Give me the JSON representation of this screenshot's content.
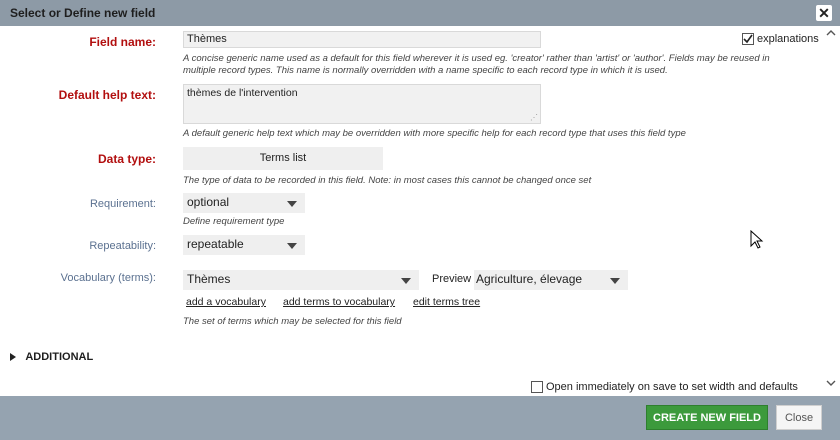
{
  "dialog": {
    "title": "Select or Define new field",
    "close_icon": "close-icon"
  },
  "field_name": {
    "label": "Field name:",
    "value": "Thèmes",
    "help": "A concise generic name used as a default for this field wherever it is used eg. 'creator' rather than 'artist' or 'author'. Fields may be reused in multiple record types. This name is normally overridden with a name specific to each record type in which it is used."
  },
  "explanations": {
    "label": "explanations",
    "checked": true
  },
  "default_help": {
    "label": "Default help text:",
    "value": "thèmes de l'intervention",
    "help": "A default generic help text which may be overridden with more specific help for each record type that uses this field type"
  },
  "data_type": {
    "label": "Data type:",
    "value": "Terms list",
    "help": "The type of data to be recorded in this field. Note: in most cases this cannot be changed once set"
  },
  "requirement": {
    "label": "Requirement:",
    "value": "optional",
    "help": "Define requirement type"
  },
  "repeatability": {
    "label": "Repeatability:",
    "value": "repeatable"
  },
  "vocabulary": {
    "label": "Vocabulary (terms):",
    "value": "Thèmes",
    "preview_label": "Preview",
    "preview_value": "Agriculture, élevage",
    "links": [
      "add a vocabulary",
      "add terms to vocabulary",
      "edit terms tree"
    ],
    "help": "The set of terms which may be selected for this field"
  },
  "additional": {
    "label": "ADDITIONAL"
  },
  "open_immediately": {
    "label": "Open immediately on save to set width and defaults",
    "checked": false
  },
  "buttons": {
    "create": "CREATE NEW FIELD",
    "close": "Close"
  },
  "colors": {
    "required_label": "#b20f0f",
    "create_button": "#3c9a3c",
    "titlebar": "#8d9aa6",
    "footer": "#95a3b0"
  }
}
